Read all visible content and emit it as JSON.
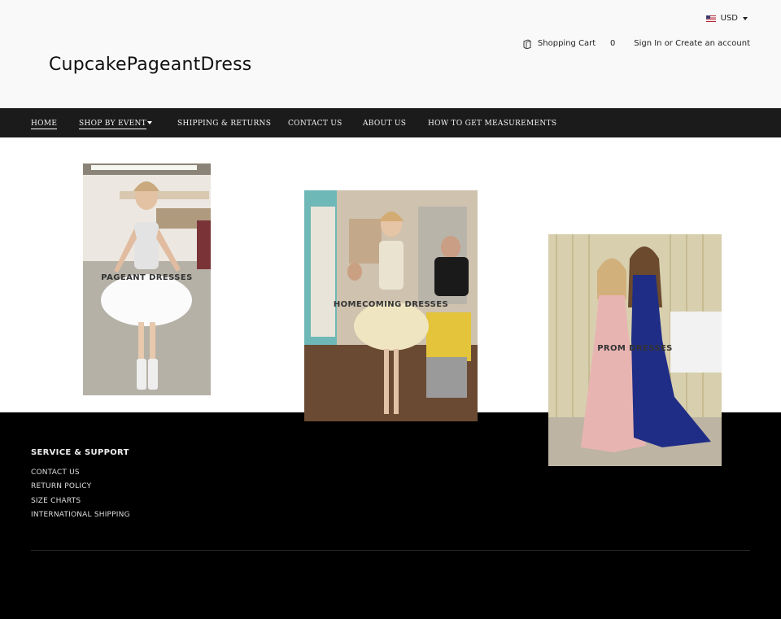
{
  "header": {
    "currency": "USD",
    "cart_label": "Shopping Cart",
    "cart_count": "0",
    "sign_in": "Sign In",
    "or": "or",
    "create_account": "Create an account",
    "logo": "CupcakePageantDress"
  },
  "nav": {
    "items": [
      "HOME",
      "SHOP BY EVENT",
      "SHIPPING & RETURNS",
      "CONTACT US",
      "ABOUT US",
      "HOW TO GET MEASUREMENTS"
    ]
  },
  "collections": [
    {
      "label": "PAGEANT DRESSES"
    },
    {
      "label": "HOMECOMING DRESSES"
    },
    {
      "label": "PROM DRESSES"
    }
  ],
  "footer": {
    "title": "SERVICE & SUPPORT",
    "links": [
      "CONTACT US",
      "RETURN POLICY",
      "SIZE CHARTS",
      "INTERNATIONAL SHIPPING"
    ]
  },
  "colors": {
    "header_bg": "#f9f9f9",
    "nav_bg": "#1b1b1b",
    "footer_bg": "#000000"
  }
}
